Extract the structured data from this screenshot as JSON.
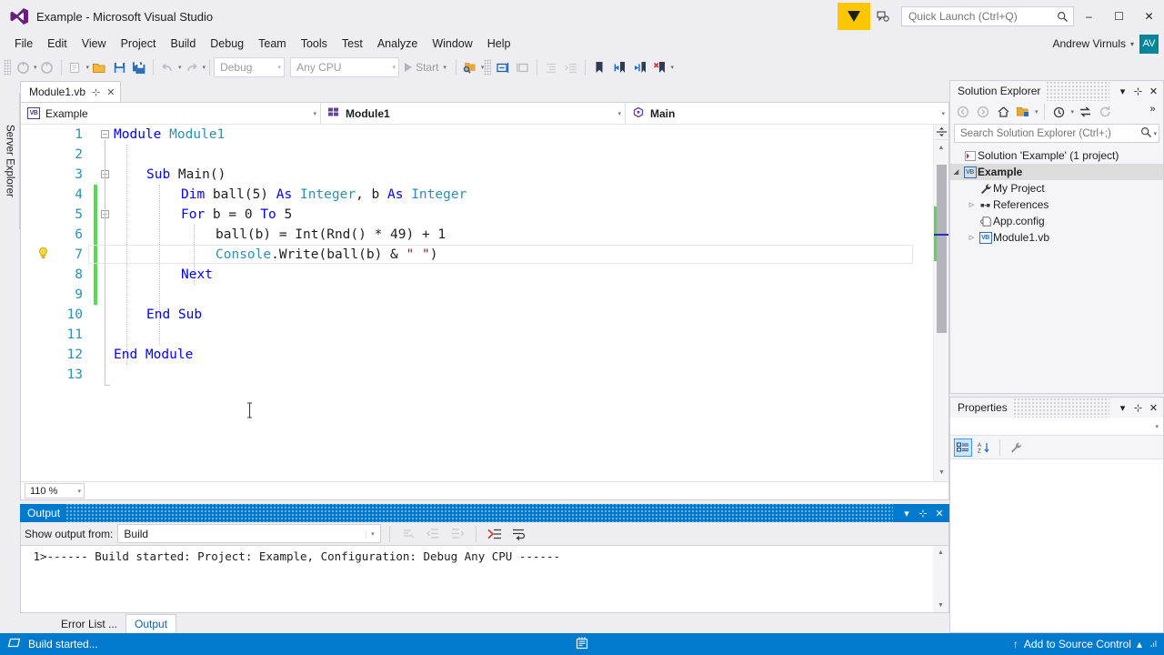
{
  "window": {
    "title": "Example - Microsoft Visual Studio",
    "minimize": "–",
    "maximize": "☐",
    "close": "✕"
  },
  "quick_launch": {
    "placeholder": "Quick Launch (Ctrl+Q)"
  },
  "menu": {
    "items": [
      "File",
      "Edit",
      "View",
      "Project",
      "Build",
      "Debug",
      "Team",
      "Tools",
      "Test",
      "Analyze",
      "Window",
      "Help"
    ]
  },
  "account": {
    "name": "Andrew Virnuls",
    "initials": "AV",
    "caret": "▾"
  },
  "toolbar": {
    "config": "Debug",
    "platform": "Any CPU",
    "start": "Start",
    "caret": "▾"
  },
  "left_strip": {
    "server_explorer": "Server Explorer"
  },
  "document_tab": {
    "name": "Module1.vb",
    "pin": "⊹",
    "close": "✕"
  },
  "nav_bar": {
    "project": "Example",
    "type": "Module1",
    "member": "Main",
    "caret": "▾"
  },
  "editor": {
    "zoom": "110 %",
    "line_numbers": [
      "1",
      "2",
      "3",
      "4",
      "5",
      "6",
      "7",
      "8",
      "9",
      "10",
      "11",
      "12",
      "13"
    ],
    "lines": [
      {
        "n": 1,
        "indent": 0,
        "tokens": [
          {
            "t": "Module ",
            "c": "kw"
          },
          {
            "t": "Module1",
            "c": "cls"
          }
        ]
      },
      {
        "n": 2,
        "indent": 0,
        "tokens": []
      },
      {
        "n": 3,
        "indent": 1,
        "tokens": [
          {
            "t": "Sub ",
            "c": "kw"
          },
          {
            "t": "Main()",
            "c": "txt"
          }
        ]
      },
      {
        "n": 4,
        "indent": 2,
        "tokens": [
          {
            "t": "Dim ",
            "c": "kw"
          },
          {
            "t": "ball(5) ",
            "c": "txt"
          },
          {
            "t": "As ",
            "c": "kw"
          },
          {
            "t": "Integer",
            "c": "cls"
          },
          {
            "t": ", b ",
            "c": "txt"
          },
          {
            "t": "As ",
            "c": "kw"
          },
          {
            "t": "Integer",
            "c": "cls"
          }
        ]
      },
      {
        "n": 5,
        "indent": 2,
        "tokens": [
          {
            "t": "For ",
            "c": "kw"
          },
          {
            "t": "b = 0 ",
            "c": "txt"
          },
          {
            "t": "To ",
            "c": "kw"
          },
          {
            "t": "5",
            "c": "txt"
          }
        ]
      },
      {
        "n": 6,
        "indent": 3,
        "tokens": [
          {
            "t": "ball(b) = Int(Rnd() * 49) + 1",
            "c": "txt"
          }
        ]
      },
      {
        "n": 7,
        "indent": 3,
        "tokens": [
          {
            "t": "Console",
            "c": "cls"
          },
          {
            "t": ".Write(ball(b) & ",
            "c": "txt"
          },
          {
            "t": "\" \"",
            "c": "str"
          },
          {
            "t": ")",
            "c": "txt"
          }
        ]
      },
      {
        "n": 8,
        "indent": 2,
        "tokens": [
          {
            "t": "Next",
            "c": "kw"
          }
        ]
      },
      {
        "n": 9,
        "indent": 0,
        "tokens": []
      },
      {
        "n": 10,
        "indent": 1,
        "tokens": [
          {
            "t": "End Sub",
            "c": "kw"
          }
        ]
      },
      {
        "n": 11,
        "indent": 0,
        "tokens": []
      },
      {
        "n": 12,
        "indent": 0,
        "tokens": [
          {
            "t": "End Module",
            "c": "kw"
          }
        ]
      },
      {
        "n": 13,
        "indent": 0,
        "tokens": []
      }
    ],
    "current_line": 7,
    "lightbulb_line": 7,
    "colors": {
      "keyword": "#0000ff",
      "class": "#2b91af",
      "string": "#a31515",
      "line_number": "#2b91af",
      "change_bar": "#57d957"
    }
  },
  "solution_explorer": {
    "title": "Solution Explorer",
    "search_placeholder": "Search Solution Explorer (Ctrl+;)",
    "caret": "▾",
    "pin": "⊹",
    "close": "✕",
    "overflow": "»",
    "nodes": [
      {
        "label": "Solution 'Example' (1 project)",
        "indent": 0,
        "expander": "",
        "icon": "solution-icon",
        "selected": false
      },
      {
        "label": "Example",
        "indent": 1,
        "expander": "◢",
        "icon": "vb-project-icon",
        "selected": true
      },
      {
        "label": "My Project",
        "indent": 2,
        "expander": "",
        "icon": "wrench-icon",
        "selected": false
      },
      {
        "label": "References",
        "indent": 2,
        "expander": "▷",
        "icon": "references-icon",
        "selected": false
      },
      {
        "label": "App.config",
        "indent": 2,
        "expander": "",
        "icon": "config-icon",
        "selected": false
      },
      {
        "label": "Module1.vb",
        "indent": 2,
        "expander": "▷",
        "icon": "vb-file-icon",
        "selected": false
      }
    ]
  },
  "properties": {
    "title": "Properties",
    "caret": "▾",
    "pin": "⊹",
    "close": "✕",
    "value": ""
  },
  "output": {
    "title": "Output",
    "caret": "▾",
    "pin": "⊹",
    "close": "✕",
    "source_label": "Show output from:",
    "source_value": "Build",
    "text": " 1>------ Build started: Project: Example, Configuration: Debug Any CPU ------"
  },
  "bottom_tabs": [
    {
      "label": "Error List ...",
      "active": false
    },
    {
      "label": "Output",
      "active": true
    }
  ],
  "status_bar": {
    "message": "Build started...",
    "source_control": "Add to Source Control",
    "caret": "▴",
    "accent": "#007acc"
  }
}
